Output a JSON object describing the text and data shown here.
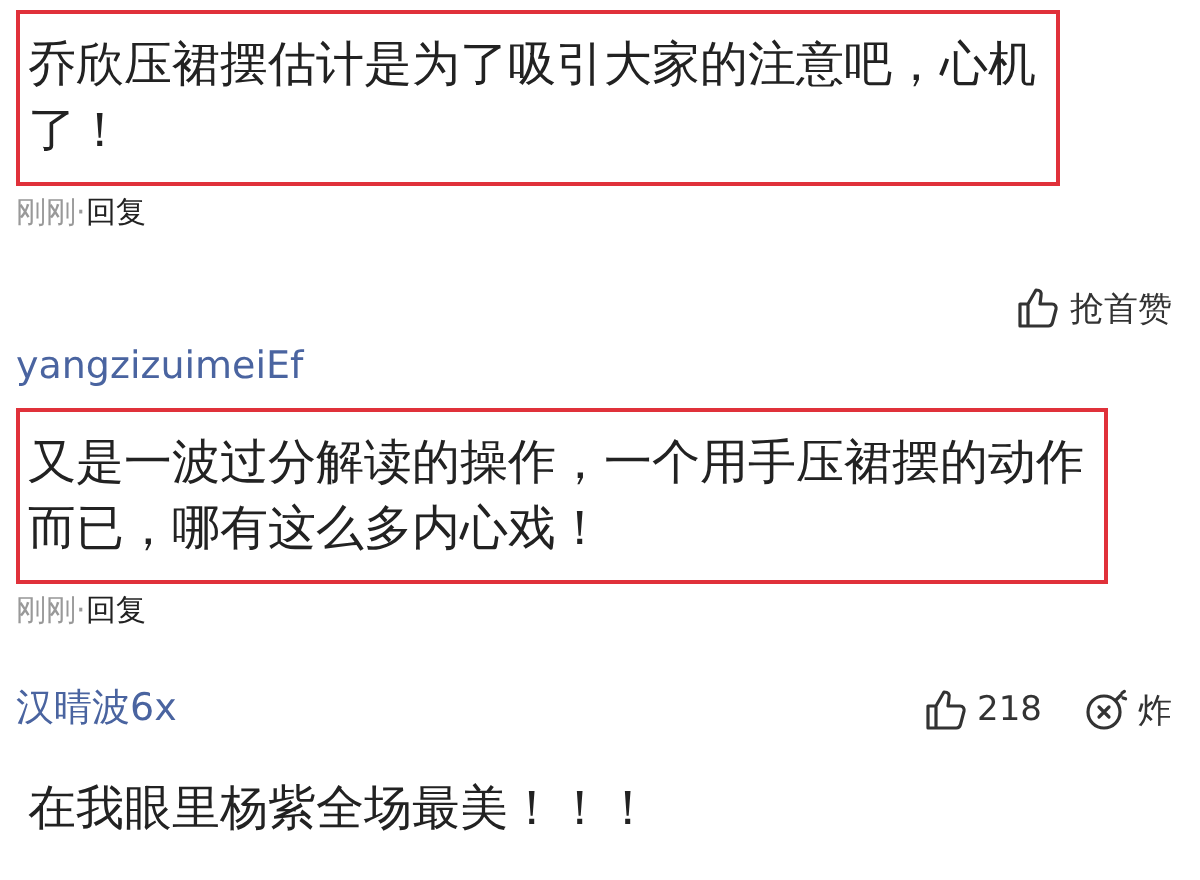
{
  "comments": [
    {
      "lines": [
        "乔欣压裙摆估计是为了吸引大家的注意吧，心机",
        "了！"
      ],
      "highlighted": true,
      "time": "刚刚·",
      "reply": "回复"
    },
    {
      "author": "yangzizuimeiEf",
      "like_label": "抢首赞",
      "lines": [
        "又是一波过分解读的操作，一个用手压裙摆的动作",
        "而已，哪有这么多内心戏！"
      ],
      "highlighted": true,
      "time": "刚刚·",
      "reply": "回复"
    },
    {
      "author": "汉晴波6x",
      "like_label": "218",
      "bomb_label": "炸",
      "lines": [
        "在我眼里杨紫全场最美！！！"
      ],
      "highlighted": false
    }
  ]
}
